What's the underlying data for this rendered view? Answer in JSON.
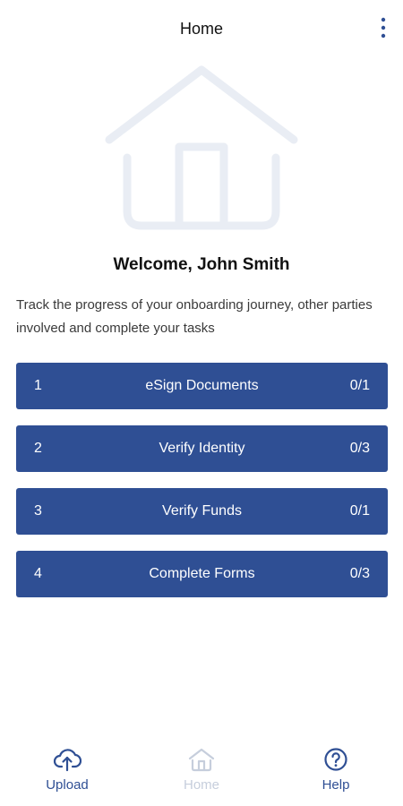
{
  "header": {
    "title": "Home",
    "menu_icon": "more-vertical-icon"
  },
  "hero": {
    "icon": "house-illustration",
    "color": "#e9edf4"
  },
  "welcome": {
    "title": "Welcome, John Smith",
    "subtitle": "Track the progress of your onboarding journey, other parties involved and complete your tasks"
  },
  "tasks": [
    {
      "number": "1",
      "label": "eSign Documents",
      "progress": "0/1"
    },
    {
      "number": "2",
      "label": "Verify Identity",
      "progress": "0/3"
    },
    {
      "number": "3",
      "label": "Verify Funds",
      "progress": "0/1"
    },
    {
      "number": "4",
      "label": "Complete Forms",
      "progress": "0/3"
    }
  ],
  "nav": {
    "items": [
      {
        "label": "Upload",
        "icon": "cloud-upload-icon",
        "active": true
      },
      {
        "label": "Home",
        "icon": "home-icon",
        "active": false
      },
      {
        "label": "Help",
        "icon": "help-circle-icon",
        "active": true
      }
    ]
  },
  "colors": {
    "primary": "#2f4f94",
    "disabled": "#c6cedc"
  }
}
